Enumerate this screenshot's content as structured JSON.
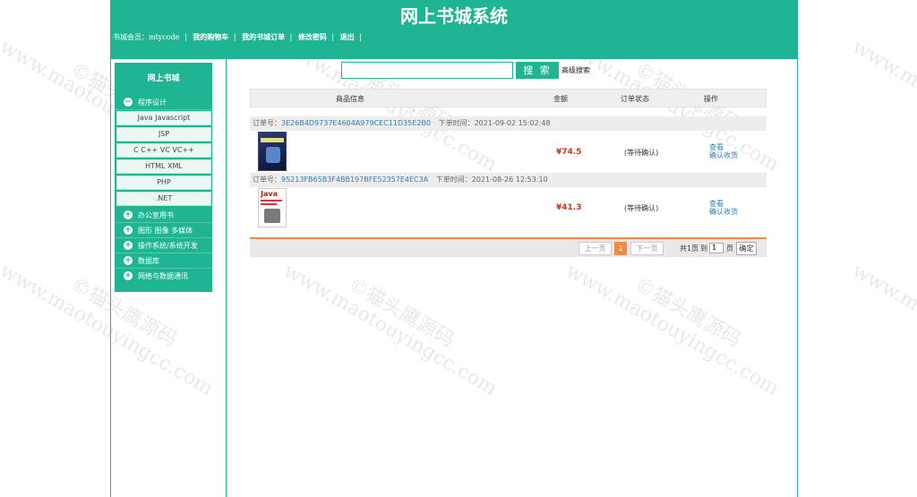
{
  "header": {
    "site_title": "网上书城系统",
    "member_label": "书城会员：",
    "username": "mtycode",
    "nav": [
      "我的购物车",
      "我的书城订单",
      "修改密码",
      "退出"
    ],
    "separator": "|"
  },
  "sidebar": {
    "title": "网上书城",
    "categories": [
      {
        "label": "程序设计",
        "icon": "minus-icon",
        "expanded": true,
        "subitems": [
          "Java Javascript",
          "JSP",
          "C C++ VC VC++",
          "HTML XML",
          "PHP",
          ".NET"
        ]
      },
      {
        "label": "办公室用书",
        "icon": "plus-icon"
      },
      {
        "label": "图形 图像 多媒体",
        "icon": "plus-icon"
      },
      {
        "label": "操作系统/系统开发",
        "icon": "plus-icon"
      },
      {
        "label": "数据库",
        "icon": "plus-icon"
      },
      {
        "label": "网络与数据通讯",
        "icon": "plus-icon"
      }
    ],
    "icon_symbols": {
      "minus": "−",
      "plus": "+"
    }
  },
  "search": {
    "value": "",
    "button_label": "搜 索",
    "advanced_label": "高级搜索"
  },
  "orders_table": {
    "columns": [
      "商品信息",
      "金额",
      "订单状态",
      "操作"
    ],
    "order_label": "订单号：",
    "time_label": "下单时间：",
    "orders": [
      {
        "order_id": "3E26B4D9737E4604A979CEC11D35E2B0",
        "time": "2021-09-02 15:02:48",
        "price": "¥74.5",
        "status": "(等待确认)",
        "actions": [
          "查看",
          "确认收货"
        ],
        "cover_text": "Java高级教程"
      },
      {
        "order_id": "95213FB65B3F4BB197BFE52357E4EC3A",
        "time": "2021-08-26 12:53:10",
        "price": "¥41.3",
        "status": "(等待确认)",
        "actions": [
          "查看",
          "确认收货"
        ],
        "cover_text": "Java"
      }
    ]
  },
  "pagination": {
    "prev": "上一页",
    "current": "1",
    "next": "下一页",
    "total_text": "共1页",
    "goto_label": "到",
    "goto_value": "1",
    "page_unit": "页",
    "confirm": "确定"
  },
  "watermark": {
    "text": "www.maotouyingcc.com",
    "mark": "©猫头鹰源码"
  },
  "colors": {
    "accent": "#1fb593",
    "price": "#c0391b",
    "link": "#2c7fb8",
    "pager_active": "#f08a44"
  }
}
